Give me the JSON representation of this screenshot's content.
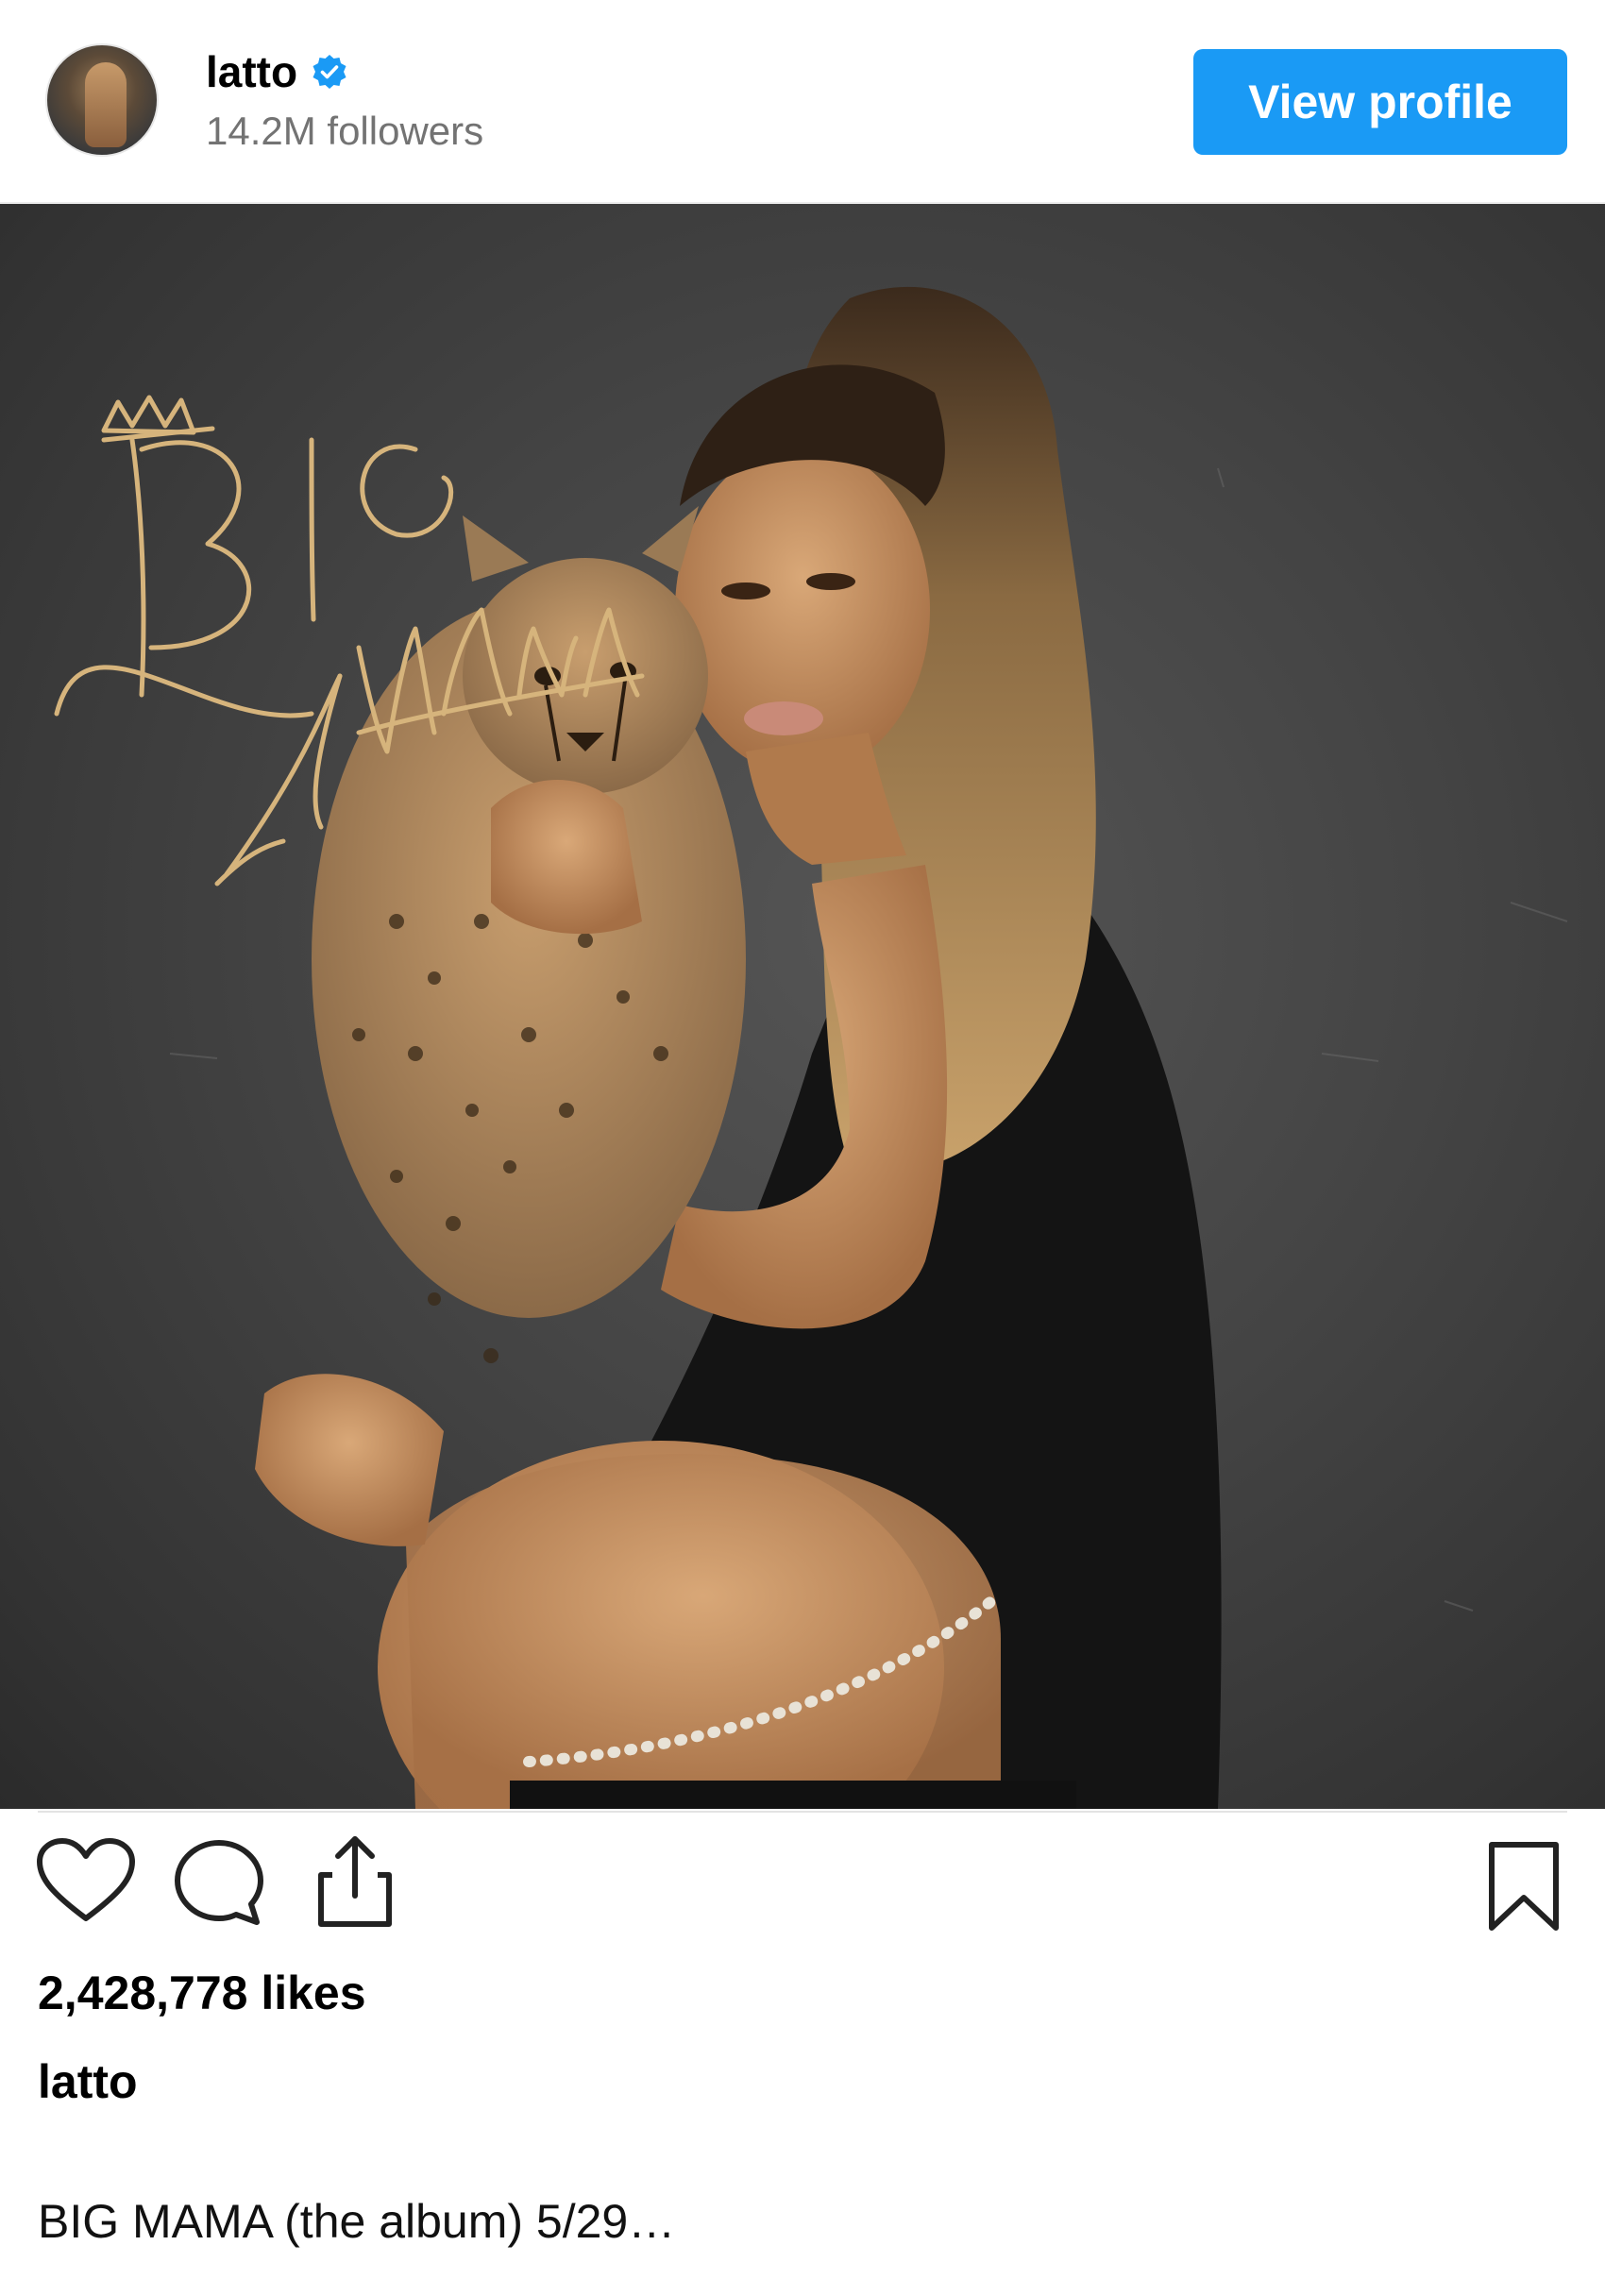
{
  "profile": {
    "username": "latto",
    "followers": "14.2M followers",
    "verified": true,
    "view_profile_label": "View profile"
  },
  "post": {
    "image_signature_text": "BIG MAMA",
    "likes": "2,428,778 likes",
    "caption_user": "latto",
    "caption_text": "BIG MAMA (the album) 5/29…"
  },
  "icons": {
    "like": "heart-icon",
    "comment": "comment-icon",
    "share": "share-icon",
    "save": "bookmark-icon",
    "verified": "verified-badge-icon"
  },
  "colors": {
    "accent": "#1a9af5",
    "muted_text": "#737373",
    "signature_gold": "#d6b47c"
  }
}
